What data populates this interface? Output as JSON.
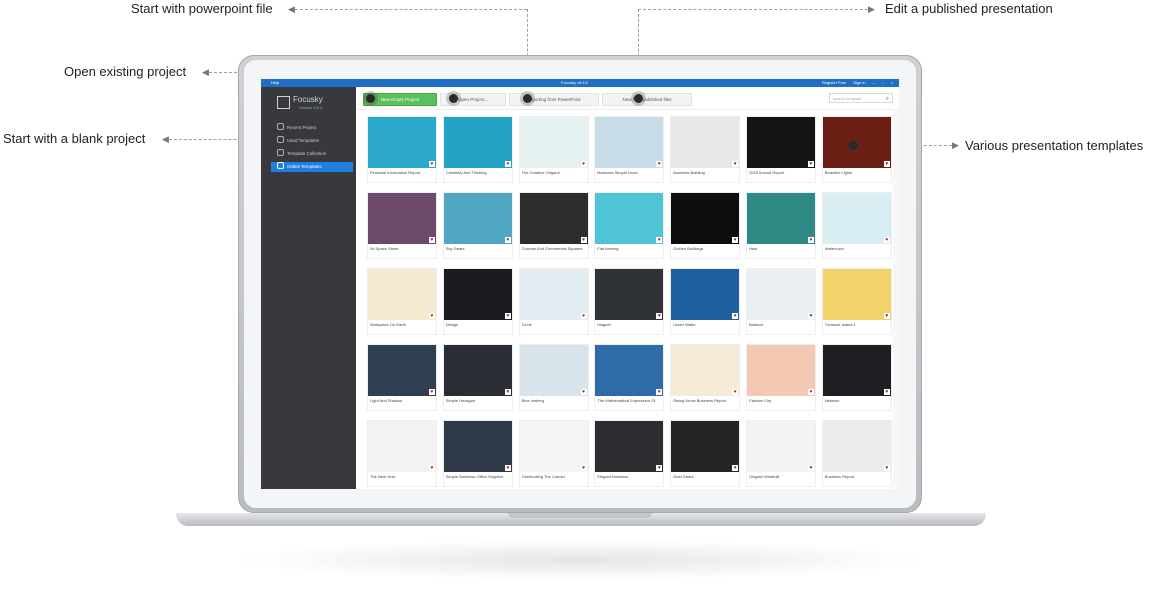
{
  "callouts": {
    "powerpoint": "Start with powerpoint file",
    "published": "Edit a published presentation",
    "existing": "Open existing project",
    "blank": "Start with a blank project",
    "templates": "Various presentation templates"
  },
  "window": {
    "menu": "Help",
    "title": "Focusky v3.6.0",
    "register": "Register Free",
    "signin": "Sign in",
    "minimize": "–",
    "restore": "▫",
    "close": "×"
  },
  "sidebar": {
    "logo": "Focusky",
    "version": "Version 3.6.0",
    "items": [
      "Recent Project",
      "Used Templates",
      "Template Collection",
      "Online Templates"
    ]
  },
  "toolbar": {
    "new": "New Empty Project",
    "open": "Open Project...",
    "import": "Importing from PowerPoint",
    "publish": "New from published files",
    "search_placeholder": "search template",
    "search_icon": "search-icon"
  },
  "templates": [
    "Financial Information Report",
    "Creativity And Thinking",
    "The Creative Origami",
    "Business Simple Lines",
    "Business Building",
    "2016 Annual Report",
    "Beautiful Lights",
    "3d Space Stone",
    "Sky Gears",
    "Concise And Commercial Squares",
    "Flat Iceberg",
    "Golden Buildings",
    "Halo",
    "Watercolor",
    "Workplace On Earth",
    "Design",
    "Circle",
    "Magnet",
    "Under Water",
    "Balance",
    "Treasure Island 1",
    "Light And Shadow",
    "Simple Hexagon",
    "Blue Iceberg",
    "The Mathematical Expression Of",
    "Rising Arrow Business Report",
    "Fashion City",
    "Network",
    "The New Year",
    "Simple Business Office Supplies",
    "Overlooking The Cuboid",
    "Elegant Business",
    "Gold Gears",
    "Origami Windmill",
    "Business Report"
  ],
  "heart_glyph": "♥",
  "thumb_colors": [
    "#2aa7c9",
    "#25a3c4",
    "#e6f2f1",
    "#c8dde8",
    "#e8e8e8",
    "#141414",
    "#6b1e14",
    "#6b4a6a",
    "#4fa7c4",
    "#2d2d2d",
    "#4fc4d6",
    "#0e0e0e",
    "#2f8a86",
    "#d8eef2",
    "#f4ead0",
    "#1a1c22",
    "#e3ecf1",
    "#2f3236",
    "#1f5fa0",
    "#e9eff3",
    "#f2d26a",
    "#2f3e50",
    "#2a2d33",
    "#d8e3ea",
    "#2e6ca8",
    "#f5ecd8",
    "#f3c9b3",
    "#1e1f22",
    "#f2f2f2",
    "#2f3a48",
    "#f5f5f5",
    "#2b2d30",
    "#252527",
    "#f1f3f5",
    "#ececec"
  ]
}
